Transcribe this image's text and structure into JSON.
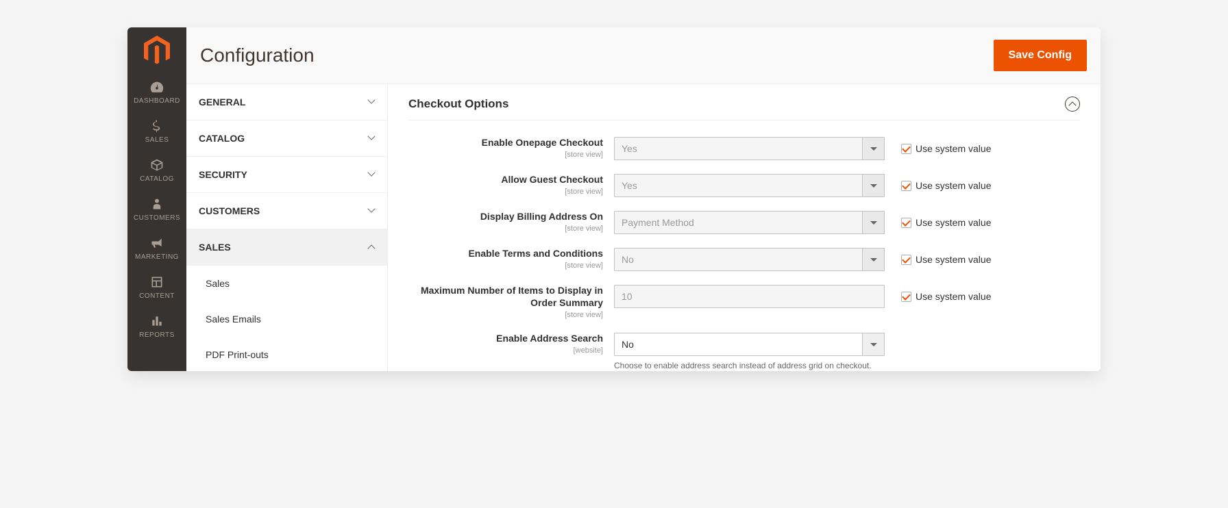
{
  "page_title": "Configuration",
  "save_button_label": "Save Config",
  "sidebar": {
    "items": [
      {
        "label": "DASHBOARD"
      },
      {
        "label": "SALES"
      },
      {
        "label": "CATALOG"
      },
      {
        "label": "CUSTOMERS"
      },
      {
        "label": "MARKETING"
      },
      {
        "label": "CONTENT"
      },
      {
        "label": "REPORTS"
      }
    ]
  },
  "config_nav": {
    "groups": [
      {
        "label": "GENERAL",
        "expanded": false
      },
      {
        "label": "CATALOG",
        "expanded": false
      },
      {
        "label": "SECURITY",
        "expanded": false
      },
      {
        "label": "CUSTOMERS",
        "expanded": false
      },
      {
        "label": "SALES",
        "expanded": true
      }
    ],
    "sales_subitems": [
      "Sales",
      "Sales Emails",
      "PDF Print-outs"
    ]
  },
  "section": {
    "title": "Checkout Options"
  },
  "checkbox_label": "Use system value",
  "fields": {
    "onepage": {
      "label": "Enable Onepage Checkout",
      "scope": "[store view]",
      "value": "Yes",
      "use_system": true,
      "disabled": true
    },
    "guest": {
      "label": "Allow Guest Checkout",
      "scope": "[store view]",
      "value": "Yes",
      "use_system": true,
      "disabled": true
    },
    "billing": {
      "label": "Display Billing Address On",
      "scope": "[store view]",
      "value": "Payment Method",
      "use_system": true,
      "disabled": true
    },
    "terms": {
      "label": "Enable Terms and Conditions",
      "scope": "[store view]",
      "value": "No",
      "use_system": true,
      "disabled": true
    },
    "max_items": {
      "label": "Maximum Number of Items to Display in Order Summary",
      "scope": "[store view]",
      "value": "10",
      "use_system": true,
      "disabled": true
    },
    "address_search": {
      "label": "Enable Address Search",
      "scope": "[website]",
      "value": "No",
      "use_system": false,
      "disabled": false,
      "help": "Choose to enable address search instead of address grid on checkout."
    }
  }
}
